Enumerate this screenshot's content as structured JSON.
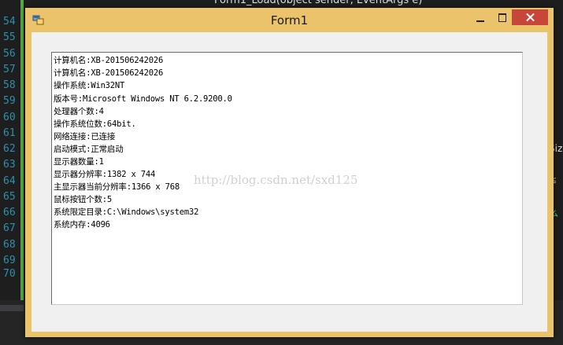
{
  "ide": {
    "line_numbers": [
      "54",
      "55",
      "56",
      "57",
      "58",
      "59",
      "60",
      "61",
      "62",
      "63",
      "64",
      "65",
      "66",
      "67",
      "68",
      "69",
      "70"
    ],
    "code_top": "Form1_Load(object sender, EventArgs e)",
    "right_fragment_1": "Siz",
    "right_fragment_2": "≤",
    "right_fragment_3": "么"
  },
  "window": {
    "title": "Form1",
    "controls": [
      "minimize",
      "maximize",
      "close"
    ]
  },
  "textbox": {
    "lines": [
      "计算机名:XB-201506242026",
      "计算机名:XB-201506242026",
      "操作系统:Win32NT",
      "版本号:Microsoft Windows NT 6.2.9200.0",
      "处理器个数:4",
      "操作系统位数:64bit.",
      "网络连接:已连接",
      "启动模式:正常启动",
      "显示器数量:1",
      "显示器分辨率:1382 x 744",
      "主显示器当前分辨率:1366 x 768",
      "鼠标按钮个数:5",
      "系统限定目录:C:\\Windows\\system32",
      "系统内存:4096"
    ],
    "watermark": "http://blog.csdn.net/sxd125"
  }
}
